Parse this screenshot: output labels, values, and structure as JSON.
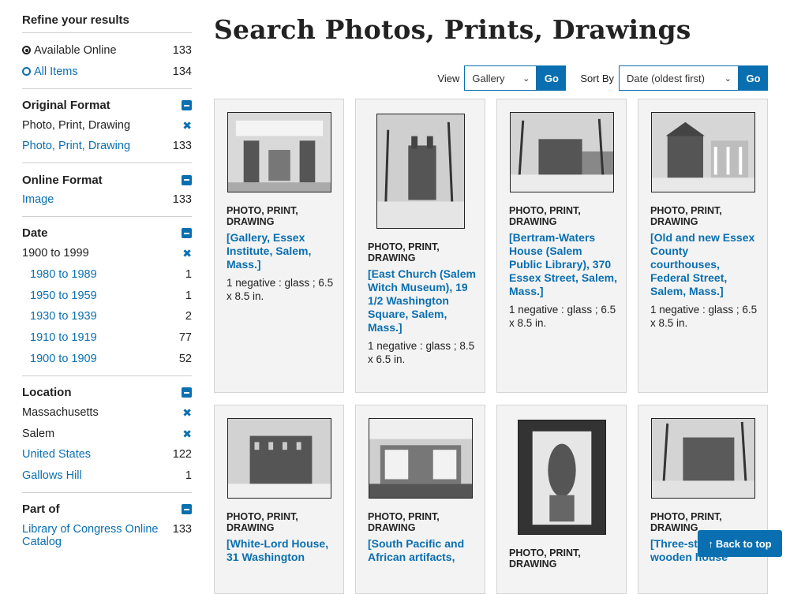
{
  "page_title": "Search Photos, Prints, Drawings",
  "sidebar": {
    "title": "Refine your results",
    "availability": [
      {
        "label": "Available Online",
        "count": "133",
        "selected": true
      },
      {
        "label": "All Items",
        "count": "134",
        "selected": false
      }
    ],
    "original_format": {
      "heading": "Original Format",
      "active": "Photo, Print, Drawing",
      "options": [
        {
          "label": "Photo, Print, Drawing",
          "count": "133"
        }
      ]
    },
    "online_format": {
      "heading": "Online Format",
      "options": [
        {
          "label": "Image",
          "count": "133"
        }
      ]
    },
    "date": {
      "heading": "Date",
      "active": "1900 to 1999",
      "options": [
        {
          "label": "1980 to 1989",
          "count": "1"
        },
        {
          "label": "1950 to 1959",
          "count": "1"
        },
        {
          "label": "1930 to 1939",
          "count": "2"
        },
        {
          "label": "1910 to 1919",
          "count": "77"
        },
        {
          "label": "1900 to 1909",
          "count": "52"
        }
      ]
    },
    "location": {
      "heading": "Location",
      "active": [
        "Massachusetts",
        "Salem"
      ],
      "options": [
        {
          "label": "United States",
          "count": "122"
        },
        {
          "label": "Gallows Hill",
          "count": "1"
        }
      ]
    },
    "part_of": {
      "heading": "Part of",
      "options": [
        {
          "label": "Library of Congress Online Catalog",
          "count": "133"
        }
      ]
    }
  },
  "controls": {
    "view_label": "View",
    "view_value": "Gallery",
    "sort_label": "Sort By",
    "sort_value": "Date (oldest first)",
    "go_label": "Go"
  },
  "results": [
    {
      "format": "PHOTO, PRINT, DRAWING",
      "title": "[Gallery, Essex Institute, Salem, Mass.]",
      "desc": "1 negative : glass ; 6.5 x 8.5 in."
    },
    {
      "format": "PHOTO, PRINT, DRAWING",
      "title": "[East Church (Salem Witch Museum), 19 1/2 Washington Square, Salem, Mass.]",
      "desc": "1 negative : glass ; 8.5 x 6.5 in."
    },
    {
      "format": "PHOTO, PRINT, DRAWING",
      "title": "[Bertram-Waters House (Salem Public Library), 370 Essex Street, Salem, Mass.]",
      "desc": "1 negative : glass ; 6.5 x 8.5 in."
    },
    {
      "format": "PHOTO, PRINT, DRAWING",
      "title": "[Old and new Essex County courthouses, Federal Street, Salem, Mass.]",
      "desc": "1 negative : glass ; 6.5 x 8.5 in."
    },
    {
      "format": "PHOTO, PRINT, DRAWING",
      "title": "[White-Lord House, 31 Washington",
      "desc": ""
    },
    {
      "format": "PHOTO, PRINT, DRAWING",
      "title": "[South Pacific and African artifacts,",
      "desc": ""
    },
    {
      "format": "PHOTO, PRINT, DRAWING",
      "title": "",
      "desc": ""
    },
    {
      "format": "PHOTO, PRINT, DRAWING",
      "title": "[Three-story wooden house",
      "desc": ""
    }
  ],
  "back_to_top": "Back to top",
  "colors": {
    "accent": "#0a6fb0",
    "card_bg": "#f3f3f3"
  }
}
